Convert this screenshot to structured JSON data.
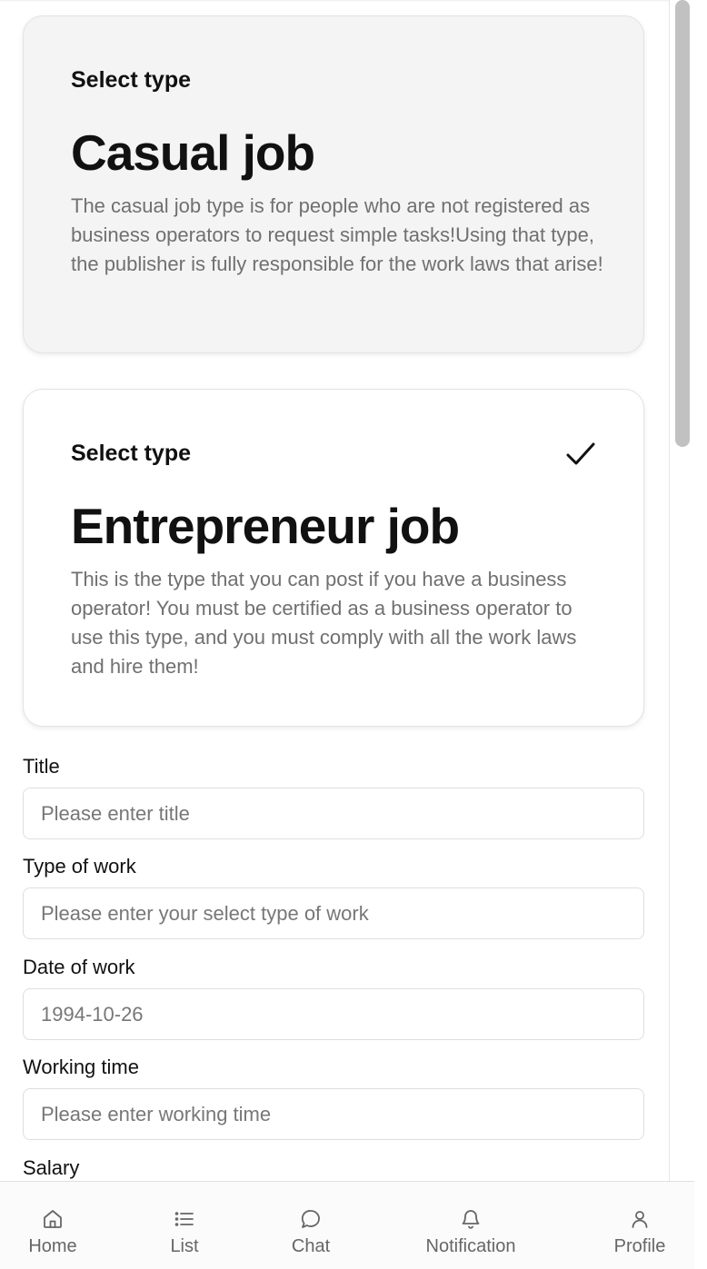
{
  "cards": [
    {
      "eyebrow": "Select type",
      "title": "Casual job",
      "description": "The casual job type is for people who are not registered as business operators to request simple tasks!Using that type, the publisher is fully responsible for the work laws that arise!",
      "selected": false
    },
    {
      "eyebrow": "Select type",
      "title": "Entrepreneur job",
      "description": "This is the type that you can post if you have a business operator! You must be certified as a business operator to use this type, and you must comply with all the work laws and hire them!",
      "selected": true
    }
  ],
  "form": {
    "title": {
      "label": "Title",
      "placeholder": "Please enter title",
      "value": ""
    },
    "type_of_work": {
      "label": "Type of work",
      "placeholder": "Please enter your select type of work",
      "value": ""
    },
    "date_of_work": {
      "label": "Date of work",
      "placeholder": "1994-10-26",
      "value": ""
    },
    "working_time": {
      "label": "Working time",
      "placeholder": "Please enter working time",
      "value": ""
    },
    "salary": {
      "label": "Salary"
    }
  },
  "nav": {
    "items": [
      {
        "label": "Home",
        "icon": "home-icon"
      },
      {
        "label": "List",
        "icon": "list-icon"
      },
      {
        "label": "Chat",
        "icon": "chat-icon"
      },
      {
        "label": "Notification",
        "icon": "bell-icon"
      },
      {
        "label": "Profile",
        "icon": "user-icon"
      }
    ]
  },
  "colors": {
    "selected_card_bg": "#ffffff",
    "unselected_card_bg": "#f4f4f4",
    "text_primary": "#111111",
    "text_secondary": "#707070",
    "nav_text": "#666666"
  }
}
